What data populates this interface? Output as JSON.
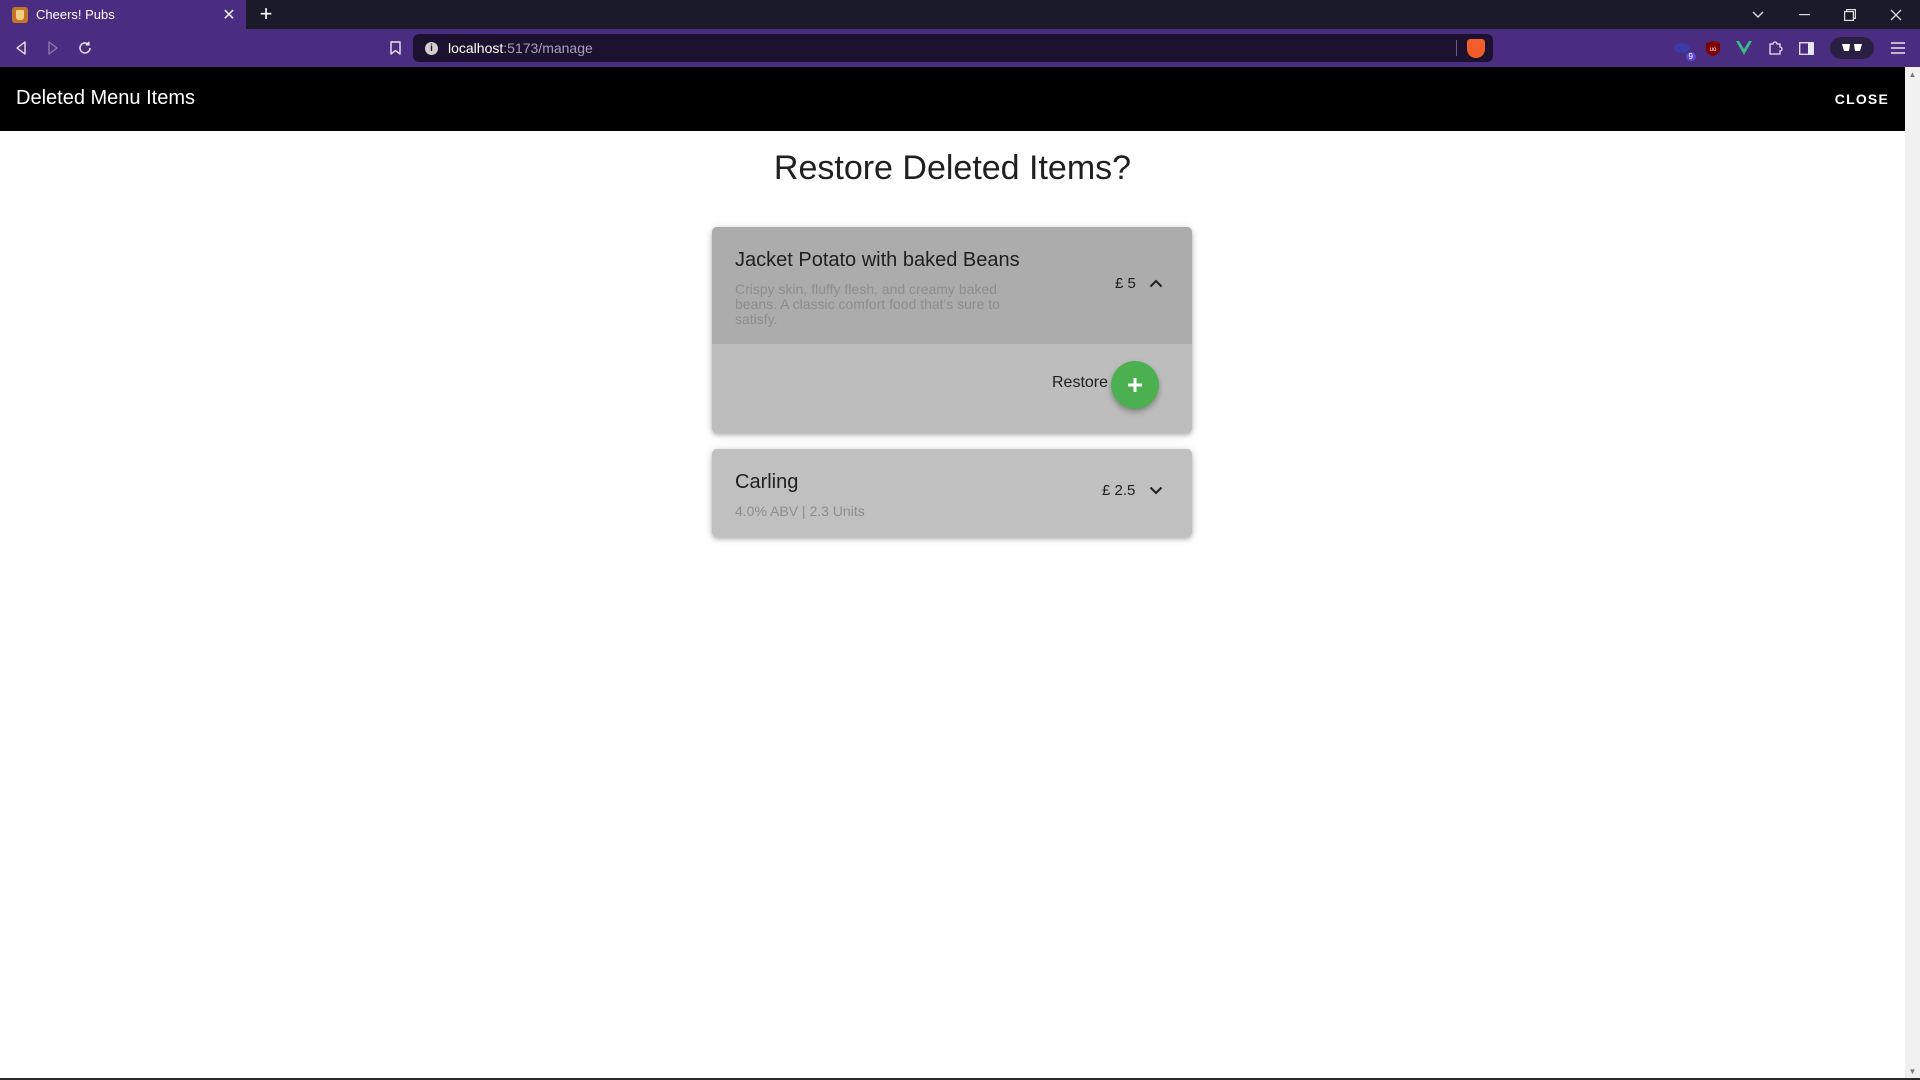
{
  "browser": {
    "tab_title": "Cheers! Pubs",
    "url_host": "localhost",
    "url_path": ":5173/manage",
    "extension_badge": "9",
    "ublock_label": "uo",
    "vue_label": "V"
  },
  "appbar": {
    "title": "Deleted Menu Items",
    "close_label": "CLOSE"
  },
  "main": {
    "heading": "Restore Deleted Items?",
    "items": [
      {
        "name": "Jacket Potato with baked Beans",
        "description": "Crispy skin, fluffy flesh, and creamy baked beans. A classic comfort food that's sure to satisfy.",
        "price": "£ 5",
        "expanded": true,
        "restore_label": "Restore"
      },
      {
        "name": "Carling",
        "description": "4.0% ABV | 2.3 Units",
        "price": "£ 2.5",
        "expanded": false
      }
    ]
  },
  "colors": {
    "appbar_bg": "#000000",
    "browser_accent": "#4a2d80",
    "restore_fab": "#4caf50",
    "card_header": "#acacac",
    "card_body": "#bdbdbd"
  }
}
